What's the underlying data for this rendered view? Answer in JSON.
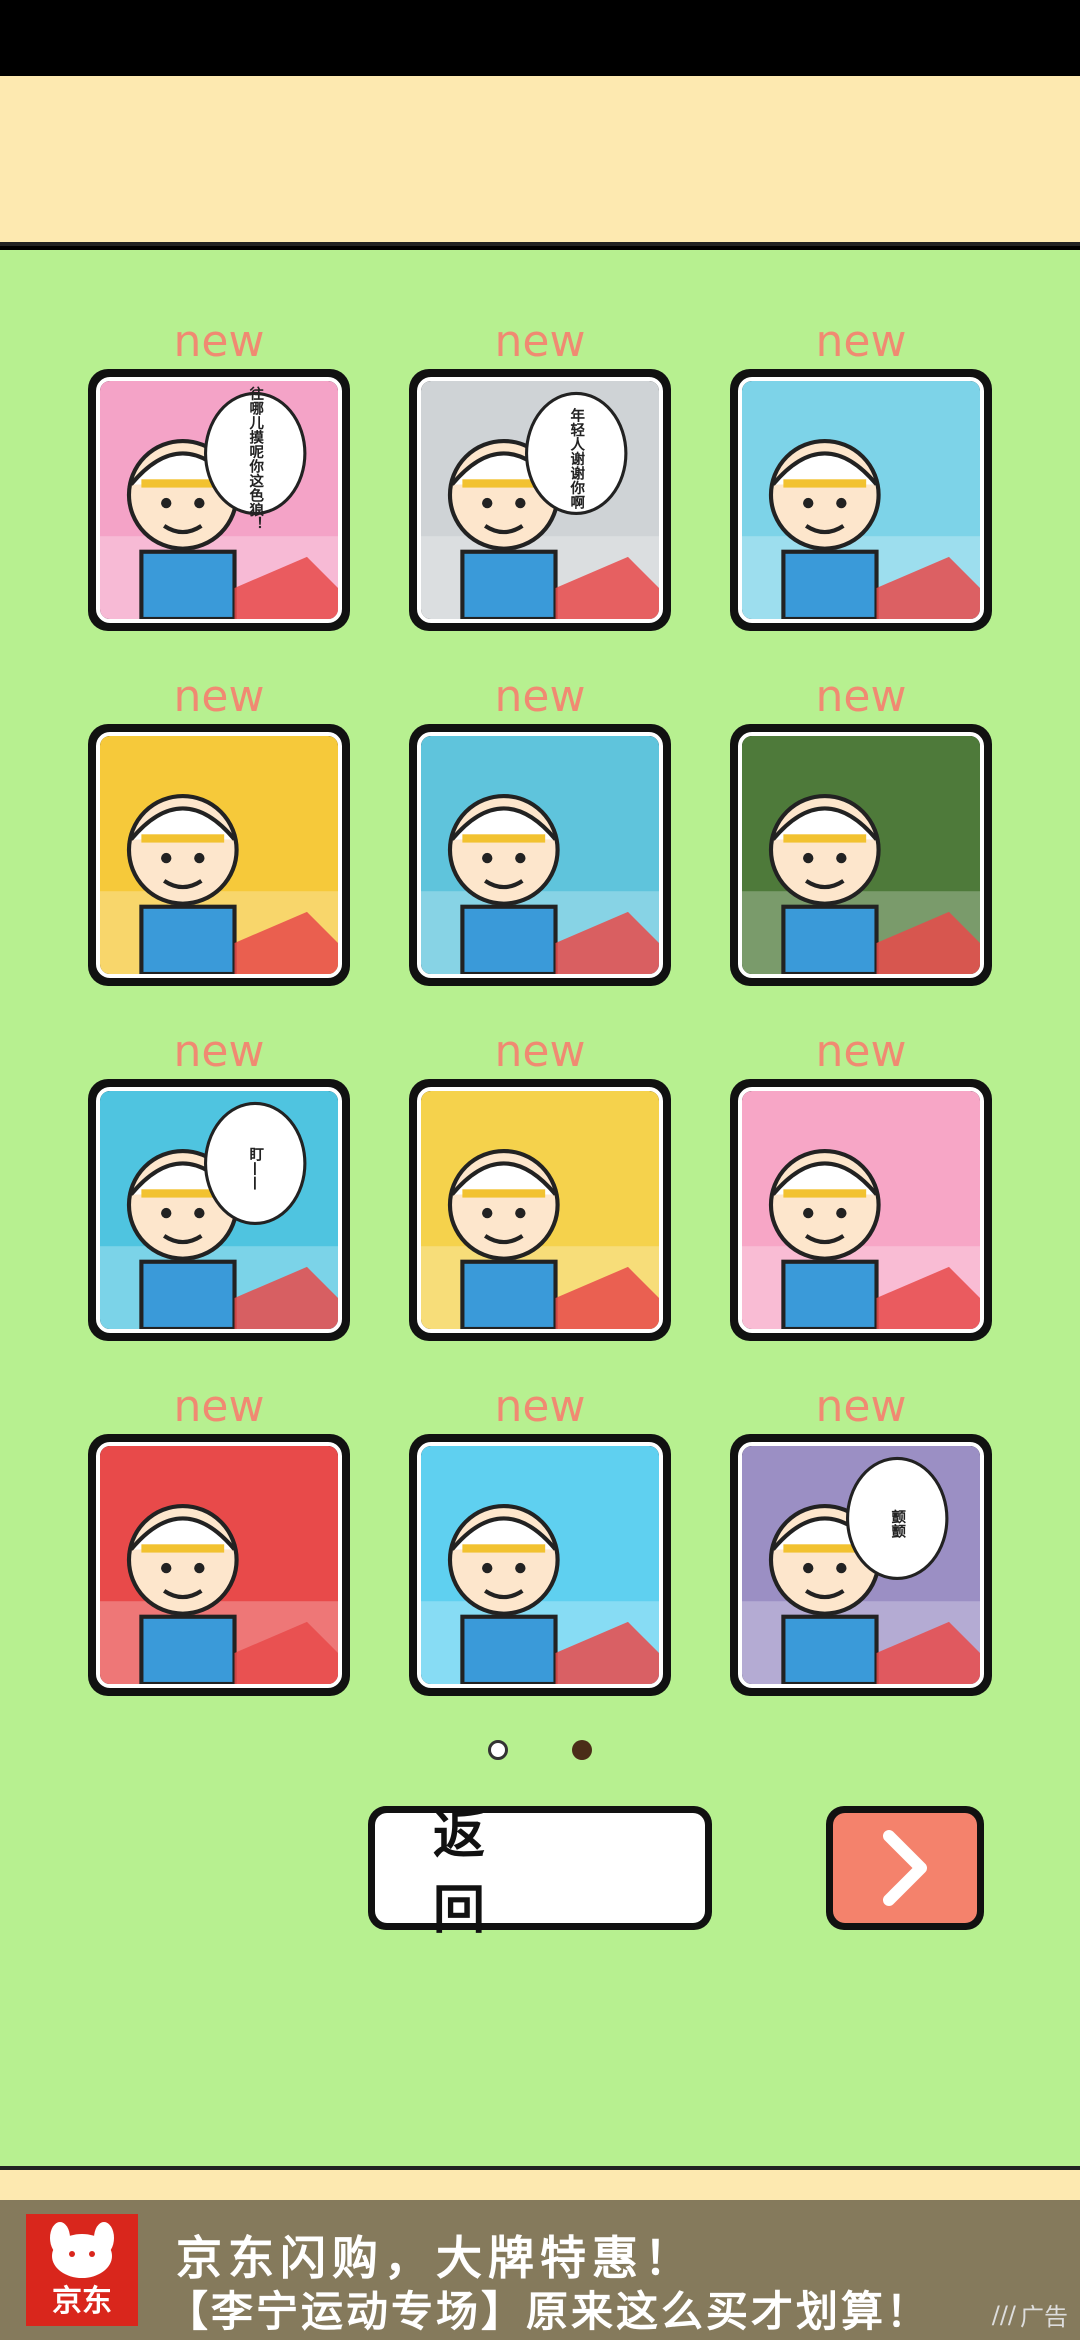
{
  "levels": [
    {
      "badge": "new",
      "bubble": "往哪儿摸呢你这色狼！",
      "theme": "#f4a3c7"
    },
    {
      "badge": "new",
      "bubble": "年轻人谢谢你啊",
      "theme": "#cfd3d6"
    },
    {
      "badge": "new",
      "bubble": "",
      "theme": "#7dd3e8"
    },
    {
      "badge": "new",
      "bubble": "",
      "theme": "#f6c93a"
    },
    {
      "badge": "new",
      "bubble": "",
      "theme": "#5fc4dc"
    },
    {
      "badge": "new",
      "bubble": "",
      "theme": "#4e7a3a"
    },
    {
      "badge": "new",
      "bubble": "盯——",
      "theme": "#4fc4e0"
    },
    {
      "badge": "new",
      "bubble": "",
      "theme": "#f5d24c"
    },
    {
      "badge": "new",
      "bubble": "",
      "theme": "#f7a6c6"
    },
    {
      "badge": "new",
      "bubble": "",
      "theme": "#e84a4a"
    },
    {
      "badge": "new",
      "bubble": "",
      "theme": "#5fd0f0"
    },
    {
      "badge": "new",
      "bubble": "颤颤",
      "theme": "#9b8fc4"
    }
  ],
  "pagination": {
    "current": 2,
    "total": 2
  },
  "buttons": {
    "back_label": "返 回",
    "next_icon": "chevron-right-icon"
  },
  "ad": {
    "brand": "京东",
    "line1": "京东闪购，大牌特惠！",
    "line2": "【李宁运动专场】原来这么买才划算！",
    "badge": "广告"
  },
  "colors": {
    "accent": "#f4826c",
    "new_label": "#f08a72",
    "background": "#b7f090",
    "band": "#fde9b0"
  }
}
